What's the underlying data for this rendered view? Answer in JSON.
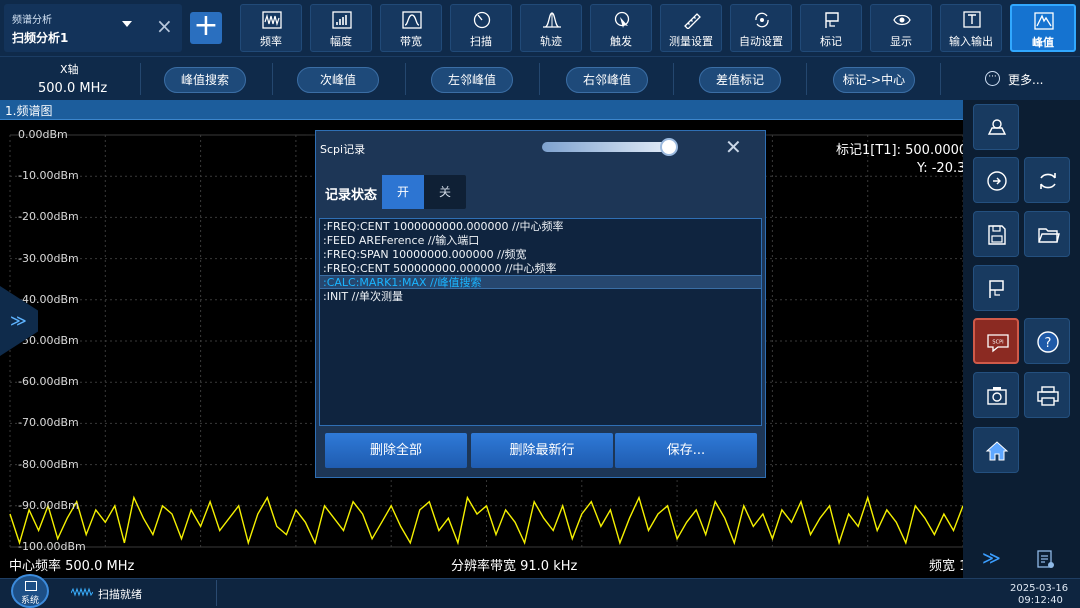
{
  "mode": {
    "category": "频谱分析",
    "name": "扫频分析1"
  },
  "toolbar": {
    "items": [
      {
        "label": "频率",
        "icon": "frequency-icon"
      },
      {
        "label": "幅度",
        "icon": "amplitude-icon"
      },
      {
        "label": "带宽",
        "icon": "bandwidth-icon"
      },
      {
        "label": "扫描",
        "icon": "sweep-icon"
      },
      {
        "label": "轨迹",
        "icon": "trace-icon"
      },
      {
        "label": "触发",
        "icon": "trigger-icon"
      },
      {
        "label": "测量设置",
        "icon": "measure-setup-icon"
      },
      {
        "label": "自动设置",
        "icon": "auto-setup-icon"
      },
      {
        "label": "标记",
        "icon": "marker-icon"
      },
      {
        "label": "显示",
        "icon": "display-icon"
      },
      {
        "label": "输入输出",
        "icon": "input-output-icon"
      },
      {
        "label": "峰值",
        "icon": "peak-icon",
        "active": true
      }
    ]
  },
  "subbar": {
    "xaxis_label": "X轴",
    "xaxis_value": "500.0 MHz",
    "buttons": [
      "峰值搜索",
      "次峰值",
      "左邻峰值",
      "右邻峰值",
      "差值标记",
      "标记->中心"
    ],
    "more": "更多..."
  },
  "pane": {
    "title": "1.频谱图",
    "marker_label": "标记1[T1]:  500.0000",
    "marker_y": "Y: -20.3",
    "center_freq": "中心频率 500.0 MHz",
    "rbw": "分辨率带宽 91.0 kHz",
    "span": "频宽 1"
  },
  "chart_data": {
    "type": "line",
    "y_tick_labels": [
      "0.00dBm",
      "-10.00dBm",
      "-20.00dBm",
      "-30.00dBm",
      "-40.00dBm",
      "-50.00dBm",
      "-60.00dBm",
      "-70.00dBm",
      "-80.00dBm",
      "-90.00dBm",
      "-100.00dBm"
    ],
    "ylim": [
      -100,
      0
    ],
    "grid": true,
    "series": [
      {
        "color": "#f4f000",
        "x": [
          0,
          1,
          2,
          3,
          4,
          5,
          6,
          7,
          8,
          9,
          10,
          11,
          12,
          13,
          14,
          15,
          16,
          17,
          18,
          19,
          20,
          21,
          22,
          23,
          24,
          25,
          26,
          27,
          28,
          29,
          30,
          31,
          32,
          33,
          34,
          35,
          36,
          37,
          38,
          39,
          40,
          41,
          42,
          43,
          44,
          45,
          46,
          47,
          48,
          49,
          50,
          51,
          52,
          53,
          54,
          55,
          56,
          57,
          58,
          59,
          60,
          61,
          62,
          63,
          64,
          65,
          66,
          67,
          68,
          69,
          70,
          71,
          72,
          73,
          74,
          75,
          76,
          77,
          78,
          79,
          80,
          81,
          82,
          83,
          84,
          85,
          86,
          87,
          88,
          89,
          90,
          91,
          92,
          93,
          94,
          95,
          96,
          97,
          98,
          99,
          100
        ],
        "y": [
          -92,
          -99,
          -91,
          -96,
          -90,
          -98,
          -93,
          -89,
          -97,
          -91,
          -94,
          -90,
          -99,
          -88,
          -93,
          -97,
          -90,
          -92,
          -98,
          -91,
          -95,
          -89,
          -96,
          -93,
          -90,
          -99,
          -92,
          -88,
          -95,
          -97,
          -91,
          -94,
          -99,
          -90,
          -93,
          -96,
          -89,
          -92,
          -98,
          -94,
          -90,
          -95,
          -99,
          -91,
          -89,
          -96,
          -93,
          -99,
          -88,
          -92,
          -90,
          -97,
          -91,
          -94,
          -99,
          -89,
          -93,
          -96,
          -90,
          -98,
          -92,
          -89,
          -95,
          -91,
          -99,
          -93,
          -88,
          -96,
          -92,
          -90,
          -98,
          -94,
          -91,
          -97,
          -89,
          -93,
          -99,
          -90,
          -95,
          -92,
          -98,
          -91,
          -94,
          -89,
          -97,
          -93,
          -90,
          -99,
          -92,
          -95,
          -88,
          -96,
          -91,
          -94,
          -99,
          -90,
          -93,
          -97,
          -92,
          -96,
          -90
        ]
      }
    ]
  },
  "dialog": {
    "title": "Scpi记录",
    "record_label": "记录状态",
    "toggle_on": "开",
    "toggle_off": "关",
    "lines": [
      ":FREQ:CENT 1000000000.000000    //中心频率",
      ":FEED AREFerence    //输入端口",
      ":FREQ:SPAN 10000000.000000    //频宽",
      ":FREQ:CENT 500000000.000000    //中心频率",
      ":CALC:MARK1:MAX    //峰值搜索",
      ":INIT    //单次测量"
    ],
    "selected_index": 4,
    "buttons": [
      "删除全部",
      "删除最新行",
      "保存..."
    ]
  },
  "status": {
    "system_label": "系统",
    "scan_state": "扫描就绪",
    "date": "2025-03-16",
    "time": "09:12:40"
  },
  "colors": {
    "accent": "#1573d0",
    "trace": "#f4f000",
    "panel": "#0f2a4a",
    "scpi_active": "#8b2a22"
  }
}
